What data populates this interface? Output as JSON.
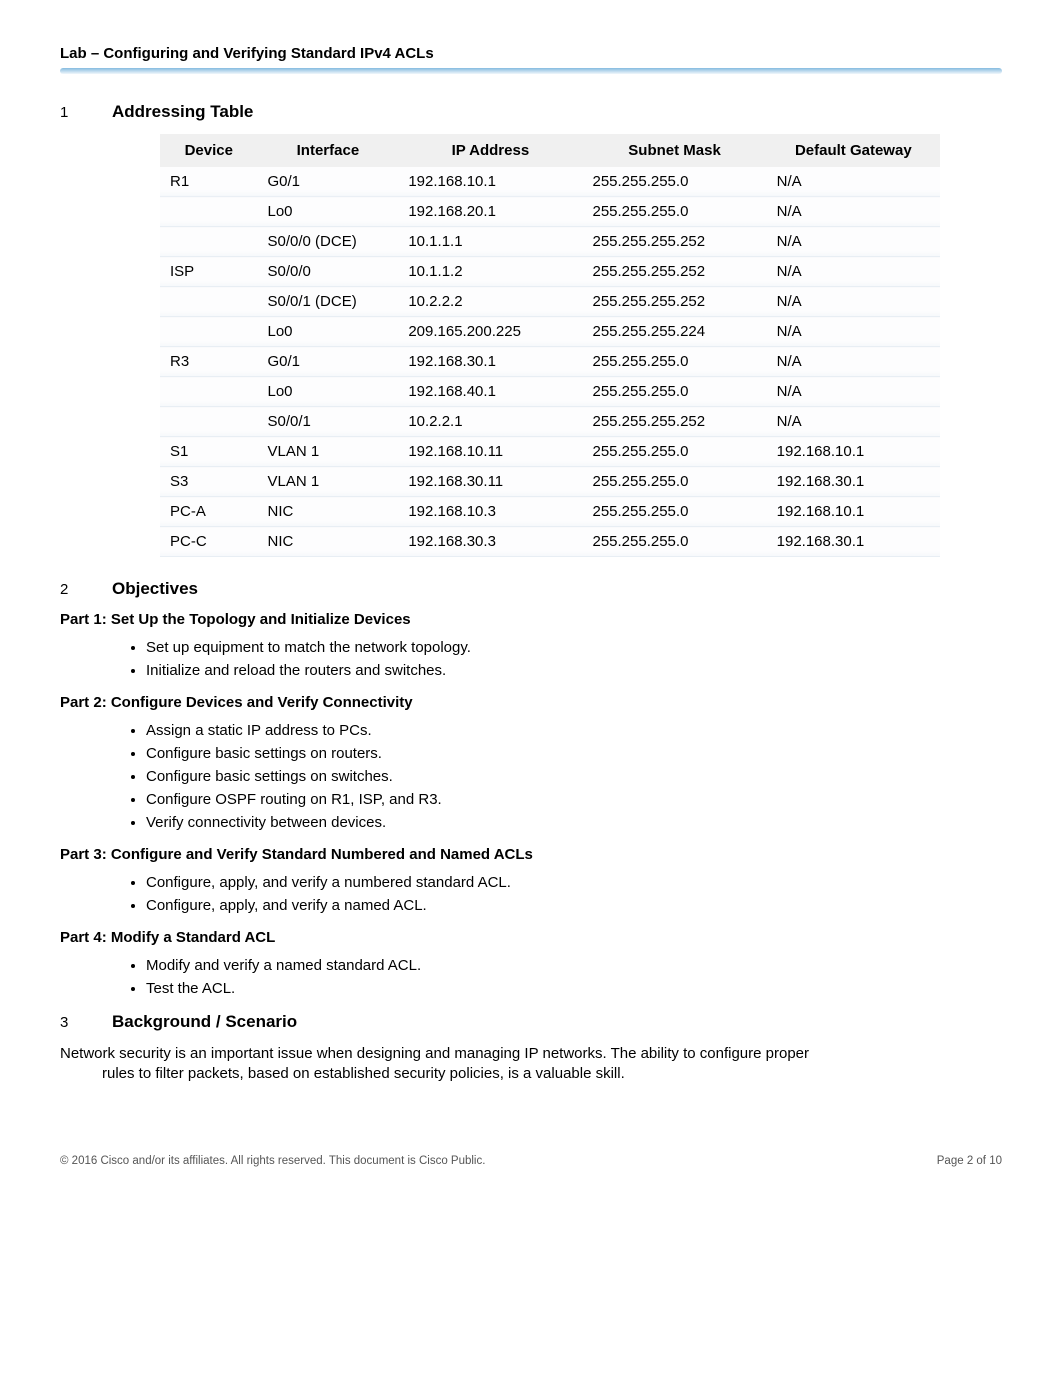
{
  "header": {
    "title": "Lab – Configuring and Verifying Standard IPv4 ACLs"
  },
  "sections": {
    "addressing": {
      "num": "1",
      "name": "Addressing Table"
    },
    "objectives": {
      "num": "2",
      "name": "Objectives"
    },
    "background": {
      "num": "3",
      "name": "Background / Scenario"
    }
  },
  "table": {
    "headers": {
      "device": "Device",
      "iface": "Interface",
      "ip": "IP Address",
      "mask": "Subnet Mask",
      "gw": "Default Gateway"
    },
    "rows": [
      {
        "device": "R1",
        "iface": "G0/1",
        "ip": "192.168.10.1",
        "mask": "255.255.255.0",
        "gw": "N/A"
      },
      {
        "device": "",
        "iface": "Lo0",
        "ip": "192.168.20.1",
        "mask": "255.255.255.0",
        "gw": "N/A"
      },
      {
        "device": "",
        "iface": "S0/0/0 (DCE)",
        "ip": "10.1.1.1",
        "mask": "255.255.255.252",
        "gw": "N/A"
      },
      {
        "device": "ISP",
        "iface": "S0/0/0",
        "ip": "10.1.1.2",
        "mask": "255.255.255.252",
        "gw": "N/A"
      },
      {
        "device": "",
        "iface": "S0/0/1 (DCE)",
        "ip": "10.2.2.2",
        "mask": "255.255.255.252",
        "gw": "N/A"
      },
      {
        "device": "",
        "iface": "Lo0",
        "ip": "209.165.200.225",
        "mask": "255.255.255.224",
        "gw": "N/A"
      },
      {
        "device": "R3",
        "iface": "G0/1",
        "ip": "192.168.30.1",
        "mask": "255.255.255.0",
        "gw": "N/A"
      },
      {
        "device": "",
        "iface": "Lo0",
        "ip": "192.168.40.1",
        "mask": "255.255.255.0",
        "gw": "N/A"
      },
      {
        "device": "",
        "iface": "S0/0/1",
        "ip": "10.2.2.1",
        "mask": "255.255.255.252",
        "gw": "N/A"
      },
      {
        "device": "S1",
        "iface": "VLAN 1",
        "ip": "192.168.10.11",
        "mask": "255.255.255.0",
        "gw": "192.168.10.1"
      },
      {
        "device": "S3",
        "iface": "VLAN 1",
        "ip": "192.168.30.11",
        "mask": "255.255.255.0",
        "gw": "192.168.30.1"
      },
      {
        "device": "PC-A",
        "iface": "NIC",
        "ip": "192.168.10.3",
        "mask": "255.255.255.0",
        "gw": "192.168.10.1"
      },
      {
        "device": "PC-C",
        "iface": "NIC",
        "ip": "192.168.30.3",
        "mask": "255.255.255.0",
        "gw": "192.168.30.1"
      }
    ]
  },
  "objectives": {
    "part1": {
      "title": "Part 1: Set Up the Topology and Initialize Devices",
      "items": [
        "Set up equipment to match the network topology.",
        "Initialize and reload the routers and switches."
      ]
    },
    "part2": {
      "title": "Part 2: Configure Devices and Verify Connectivity",
      "items": [
        "Assign a static IP address to PCs.",
        "Configure basic settings on routers.",
        "Configure basic settings on switches.",
        "Configure OSPF routing on R1, ISP, and R3.",
        "Verify connectivity between devices."
      ]
    },
    "part3": {
      "title": "Part 3: Configure and Verify Standard Numbered and Named ACLs",
      "items": [
        "Configure, apply, and verify a numbered standard ACL.",
        "Configure, apply, and verify a named ACL."
      ]
    },
    "part4": {
      "title": "Part 4: Modify a Standard ACL",
      "items": [
        "Modify and verify a named standard ACL.",
        "Test the ACL."
      ]
    }
  },
  "background": {
    "line1": "Network security is an important issue when designing and managing IP networks. The ability to configure proper",
    "line2": "rules to filter packets, based on established security policies, is a valuable skill."
  },
  "footer": {
    "copyright": "© 2016 Cisco and/or its affiliates. All rights reserved. This document is Cisco Public.",
    "page": "Page 2 of 10"
  }
}
